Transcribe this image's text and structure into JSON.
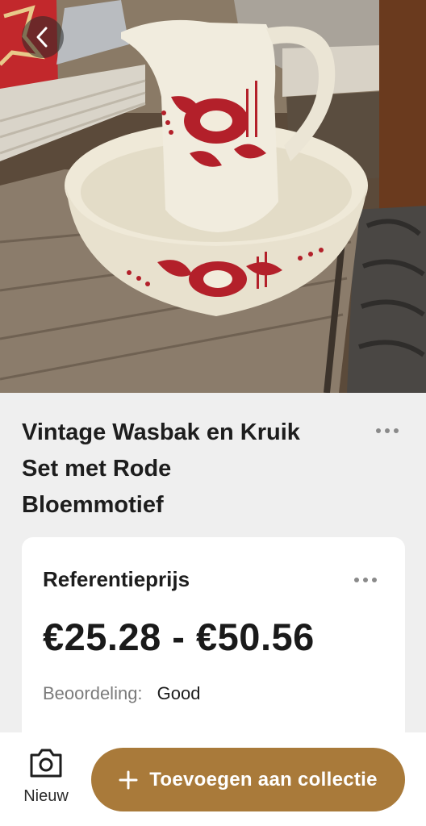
{
  "photo": {
    "alt_icon": "back-arrow-icon"
  },
  "product": {
    "title_line1": "Vintage Wasbak en Kruik",
    "title_line2": "Set met Rode",
    "title_line3": "Bloemmotief"
  },
  "card": {
    "label": "Referentieprijs",
    "price": "€25.28 - €50.56",
    "condition_label": "Beoordeling:",
    "condition_value": "Good"
  },
  "bottom_bar": {
    "new_label": "Nieuw",
    "add_label": "Toevoegen aan collectie"
  },
  "colors": {
    "accent": "#a97a3a",
    "background": "#efefef",
    "card": "#ffffff",
    "pattern_red": "#b3202a"
  }
}
